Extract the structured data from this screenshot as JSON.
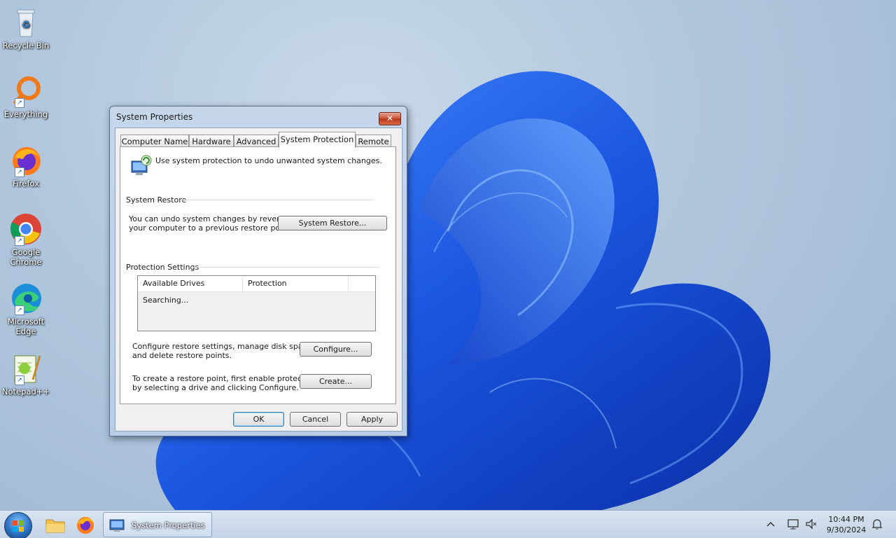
{
  "desktop": {
    "icons": [
      {
        "label": "Recycle Bin",
        "icon": "recycle-bin-icon"
      },
      {
        "label": "Everything",
        "icon": "everything-search-icon"
      },
      {
        "label": "Firefox",
        "icon": "firefox-icon"
      },
      {
        "label": "Google Chrome",
        "icon": "chrome-icon"
      },
      {
        "label": "Microsoft Edge",
        "icon": "edge-icon"
      },
      {
        "label": "Notepad++",
        "icon": "notepad-plus-plus-icon"
      }
    ]
  },
  "dialog": {
    "title": "System Properties",
    "close_label": "✕",
    "tabs": [
      {
        "label": "Computer Name",
        "active": false
      },
      {
        "label": "Hardware",
        "active": false
      },
      {
        "label": "Advanced",
        "active": false
      },
      {
        "label": "System Protection",
        "active": true
      },
      {
        "label": "Remote",
        "active": false
      }
    ],
    "intro": "Use system protection to undo unwanted system changes.",
    "system_restore": {
      "heading": "System Restore",
      "desc_line1": "You can undo system changes by reverting",
      "desc_line2": "your computer to a previous restore point.",
      "button": "System Restore..."
    },
    "protection": {
      "heading": "Protection Settings",
      "columns": [
        "Available Drives",
        "Protection"
      ],
      "status": "Searching...",
      "configure_line1": "Configure restore settings, manage disk space,",
      "configure_line2": "and delete restore points.",
      "configure_button": "Configure...",
      "create_line1": "To create a restore point, first enable protection",
      "create_line2": "by selecting a drive and clicking Configure.",
      "create_button": "Create..."
    },
    "buttons": {
      "ok": "OK",
      "cancel": "Cancel",
      "apply": "Apply"
    }
  },
  "taskbar": {
    "task_label": "System Properties",
    "clock_time": "10:44 PM",
    "clock_date": "9/30/2024"
  },
  "colors": {
    "wallpaper_blue": "#1f5fe0",
    "accent": "#3c7fb1"
  }
}
